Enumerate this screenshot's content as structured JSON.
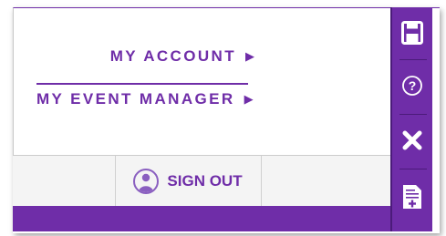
{
  "menu": {
    "my_account": {
      "label": "MY ACCOUNT",
      "arrow": "▶"
    },
    "my_event_manager": {
      "label": "MY EVENT MANAGER",
      "arrow": "▶"
    }
  },
  "footer": {
    "sign_out_label": "SIGN OUT"
  },
  "side_toolbar": {
    "buttons": [
      "save-icon",
      "help-icon",
      "close-icon",
      "add-document-icon"
    ]
  },
  "colors": {
    "accent": "#6f2da8",
    "accent_dark": "#4b1b7a",
    "footer_bg": "#f4f4f4"
  }
}
